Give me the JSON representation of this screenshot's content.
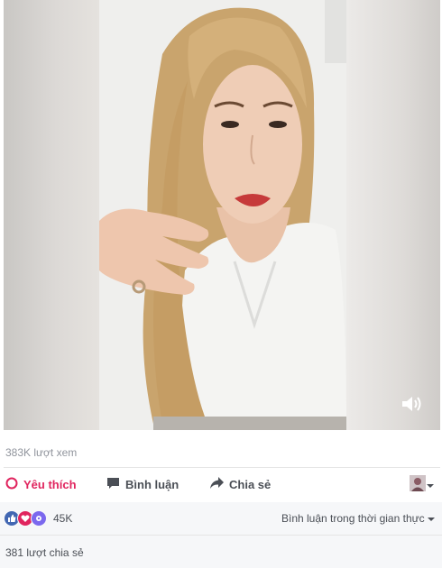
{
  "video": {
    "views": "383K lượt xem"
  },
  "actions": {
    "like_label": "Yêu thích",
    "comment_label": "Bình luận",
    "share_label": "Chia sẻ"
  },
  "reactions": {
    "count": "45K",
    "icons": [
      "like-icon",
      "love-icon",
      "wow-icon"
    ]
  },
  "comment_mode": {
    "label": "Bình luận trong thời gian thực"
  },
  "shares": {
    "label": "381 lượt chia sẻ"
  },
  "colors": {
    "like_active": "#e0245e",
    "link_blue": "#4267b2"
  }
}
